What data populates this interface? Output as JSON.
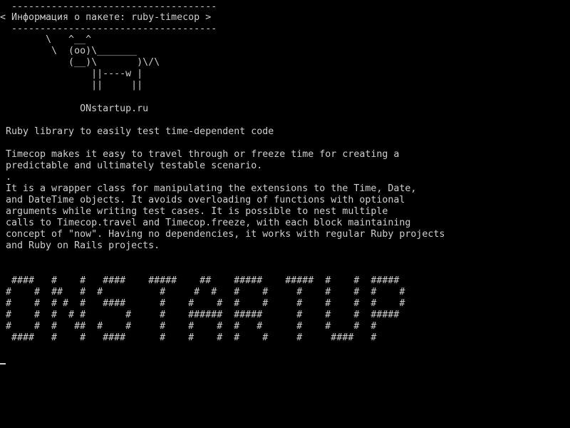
{
  "colors": {
    "background": "#000000",
    "foreground": "#cfcfcf"
  },
  "terminal": {
    "banner": {
      "top_border": " ------------------------------------",
      "title": "< Информация о пакете: ruby-timecop >",
      "bottom_border": " ------------------------------------"
    },
    "cow": [
      "       \\   ^__^",
      "        \\  (oo)\\_______",
      "           (__)\\       )\\/\\",
      "               ||----w |",
      "               ||     ||"
    ],
    "site": "             ONstartup.ru",
    "package": {
      "summary": "Ruby library to easily test time-dependent code",
      "description": [
        "Timecop makes it easy to travel through or freeze time for creating a",
        "predictable and ultimately testable scenario.",
        ".",
        "It is a wrapper class for manipulating the extensions to the Time, Date,",
        "and DateTime objects. It avoids overloading of functions with optional",
        "arguments while writing test cases. It is possible to nest multiple",
        "calls to Timecop.travel and Timecop.freeze, with each block maintaining",
        "concept of \"now\". Having no dependencies, it works with regular Ruby projects",
        "and Ruby on Rails projects."
      ]
    },
    "ascii_art": [
      " ####   #    #   ####    #####    ##    #####    #####  #    #  #####",
      "#    #  ##   #  #          #     #  #   #    #     #    #    #  #    #",
      "#    #  # #  #   ####      #    #    #  #    #     #    #    #  #    #",
      "#    #  #  # #       #     #    ######  #####      #    #    #  #####",
      "#    #  #   ##  #    #     #    #    #  #   #      #    #    #  #",
      " ####   #    #   ####      #    #    #  #    #     #     ####   #"
    ]
  }
}
